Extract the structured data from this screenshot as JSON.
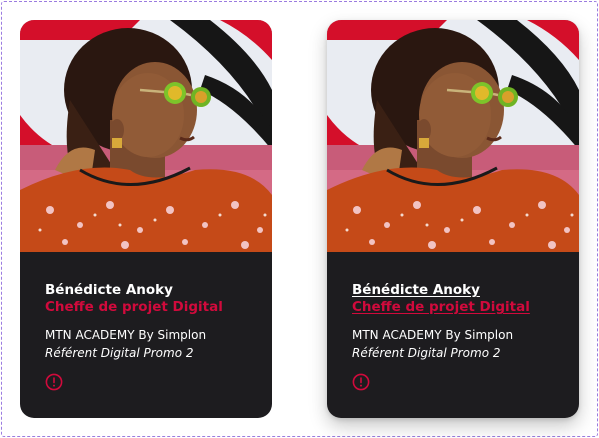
{
  "cards": [
    {
      "name": "Bénédicte Anoky",
      "role": "Cheffe de projet Digital",
      "organization": "MTN ACADEMY By Simplon",
      "promo": "Référent Digital Promo 2",
      "icon": "more-info-icon"
    },
    {
      "name": "Bénédicte Anoky",
      "role": "Cheffe de projet Digital",
      "organization": "MTN ACADEMY By Simplon",
      "promo": "Référent Digital Promo 2",
      "icon": "more-info-icon"
    }
  ],
  "colors": {
    "card_background": "#1d1c1f",
    "accent": "#d10a3c",
    "text": "#ffffff"
  }
}
